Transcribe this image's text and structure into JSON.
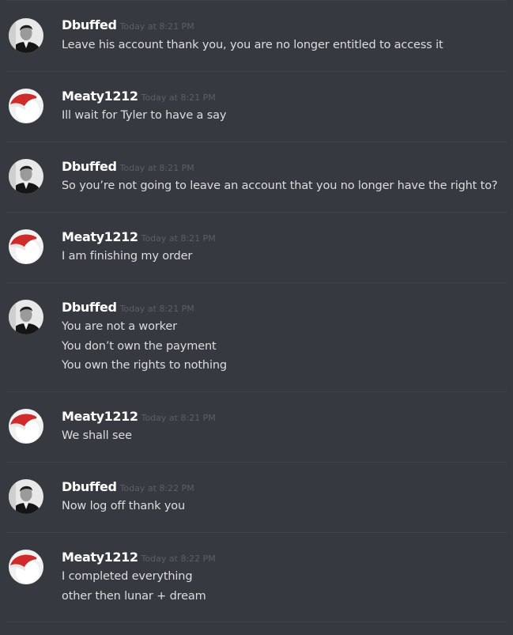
{
  "users": {
    "dbuffed": "Dbuffed",
    "meaty": "Meaty1212"
  },
  "avatars": {
    "dbuffed": "person-in-suit-avatar",
    "meaty": "red-santa-hat-avatar"
  },
  "colors": {
    "background": "#36393f",
    "username": "#ffffff",
    "message_text": "#dcddde",
    "timestamp": "#5c5f65",
    "divider": "#40434a"
  },
  "messages": [
    {
      "author": "Dbuffed",
      "avatar": "dbuffed",
      "timestamp": "Today at 8:21 PM",
      "lines": [
        "Leave his account thank you, you are no longer entitled to access it"
      ]
    },
    {
      "author": "Meaty1212",
      "avatar": "meaty",
      "timestamp": "Today at 8:21 PM",
      "lines": [
        "Ill wait for Tyler to have a say"
      ]
    },
    {
      "author": "Dbuffed",
      "avatar": "dbuffed",
      "timestamp": "Today at 8:21 PM",
      "lines": [
        "So you’re not going to leave an account that you no longer have the right to?"
      ]
    },
    {
      "author": "Meaty1212",
      "avatar": "meaty",
      "timestamp": "Today at 8:21 PM",
      "lines": [
        "I am finishing my order"
      ]
    },
    {
      "author": "Dbuffed",
      "avatar": "dbuffed",
      "timestamp": "Today at 8:21 PM",
      "lines": [
        "You are not a worker",
        "You don’t own the payment",
        "You own the rights to nothing"
      ]
    },
    {
      "author": "Meaty1212",
      "avatar": "meaty",
      "timestamp": "Today at 8:21 PM",
      "lines": [
        "We shall see"
      ]
    },
    {
      "author": "Dbuffed",
      "avatar": "dbuffed",
      "timestamp": "Today at 8:22 PM",
      "lines": [
        "Now log off thank you"
      ]
    },
    {
      "author": "Meaty1212",
      "avatar": "meaty",
      "timestamp": "Today at 8:22 PM",
      "lines": [
        "I completed everything",
        "other then lunar + dream"
      ]
    }
  ]
}
